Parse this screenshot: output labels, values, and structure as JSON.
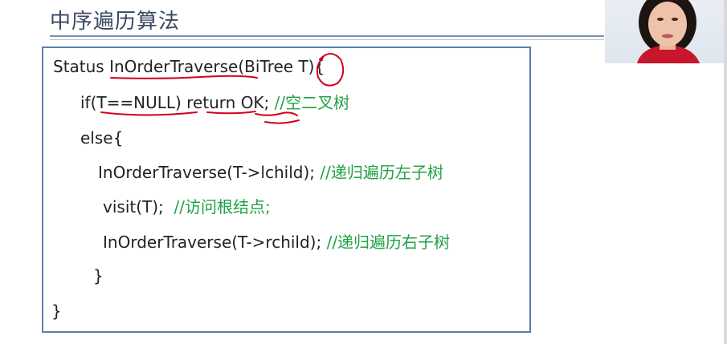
{
  "slide": {
    "title": "中序遍历算法"
  },
  "code": {
    "line1": "Status InOrderTraverse(BiTree T){",
    "line2_code": "if(T==NULL) return OK; ",
    "line2_comment": "//空二叉树",
    "line3": "else{",
    "line4_code": "InOrderTraverse(T->lchild); ",
    "line4_comment": "//递归遍历左子树",
    "line5_code": "visit(T);  ",
    "line5_comment": "//访问根结点;",
    "line6_code": "InOrderTraverse(T->rchild); ",
    "line6_comment": "//递归遍历右子树",
    "line7": "}",
    "line8": "}"
  },
  "colors": {
    "title": "#3a4a63",
    "box_border": "#5b7fae",
    "comment": "#22a046",
    "annotation_ink": "#d0021b"
  }
}
